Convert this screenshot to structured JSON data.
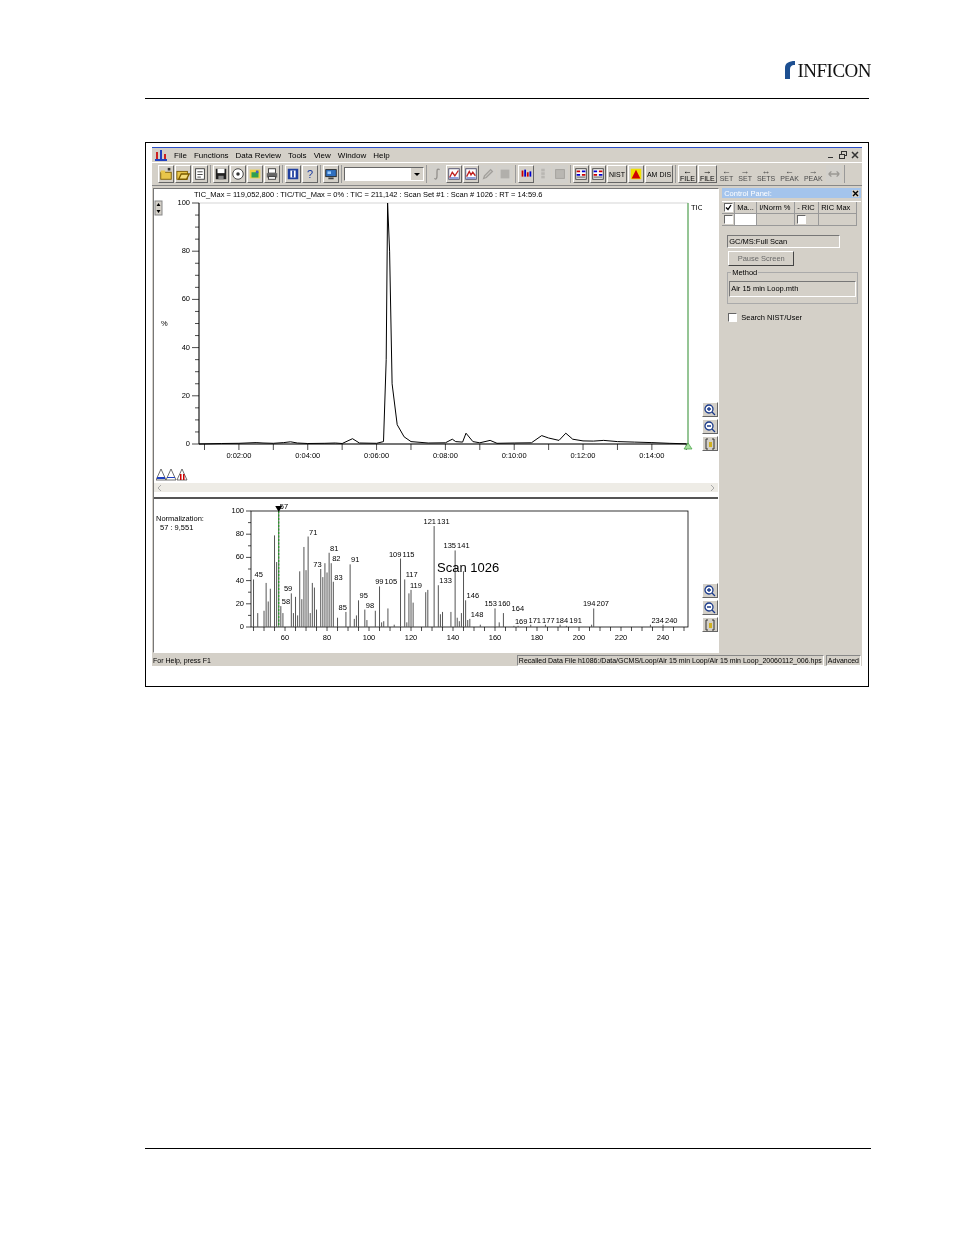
{
  "page_header": {
    "logo_text": "INFICON"
  },
  "window": {
    "menu": [
      "File",
      "Functions",
      "Data Review",
      "Tools",
      "View",
      "Window",
      "Help"
    ],
    "toolbar": [
      [
        {
          "kind": "icon",
          "disabled": false
        },
        {
          "kind": "icon",
          "disabled": false
        },
        {
          "kind": "icon",
          "disabled": false
        }
      ],
      [
        {
          "kind": "icon",
          "disabled": false
        },
        {
          "kind": "icon",
          "disabled": false
        },
        {
          "kind": "icon",
          "disabled": false
        },
        {
          "kind": "icon",
          "disabled": false
        }
      ],
      [
        {
          "kind": "icon",
          "disabled": false
        },
        {
          "kind": "text",
          "text": "?",
          "disabled": false
        }
      ],
      [
        {
          "kind": "icon",
          "disabled": false
        }
      ],
      [
        {
          "kind": "dropdown"
        }
      ],
      [
        {
          "kind": "icon",
          "disabled": true
        },
        {
          "kind": "icon",
          "disabled": false
        },
        {
          "kind": "icon",
          "disabled": false
        },
        {
          "kind": "icon",
          "disabled": true
        },
        {
          "kind": "icon",
          "disabled": true
        }
      ],
      [
        {
          "kind": "icon",
          "disabled": false
        },
        {
          "kind": "icon",
          "disabled": true
        },
        {
          "kind": "icon",
          "disabled": true
        }
      ],
      [
        {
          "kind": "icon",
          "disabled": false
        },
        {
          "kind": "icon",
          "disabled": false
        },
        {
          "kind": "text",
          "text": "NIST",
          "disabled": false
        },
        {
          "kind": "icon",
          "disabled": false
        },
        {
          "kind": "text",
          "text": "AM DIS",
          "disabled": false
        }
      ],
      [
        {
          "kind": "text",
          "text": "FILE",
          "arrow": "←",
          "disabled": false
        },
        {
          "kind": "text",
          "text": "FILE",
          "arrow": "→",
          "disabled": false
        },
        {
          "kind": "text",
          "text": "SET",
          "arrow": "←",
          "disabled": true
        },
        {
          "kind": "text",
          "text": "SET",
          "arrow": "→",
          "disabled": true
        },
        {
          "kind": "text",
          "text": "SETS",
          "arrow": "↔",
          "disabled": true
        },
        {
          "kind": "text",
          "text": "PEAK",
          "arrow": "←",
          "disabled": true
        },
        {
          "kind": "text",
          "text": "PEAK",
          "arrow": "→",
          "disabled": true
        },
        {
          "kind": "icon",
          "disabled": true
        }
      ]
    ],
    "chromatogram": {
      "header": "TIC_Max = 119,052,800 : TIC/TIC_Max = 0% : TIC = 211,142 : Scan Set #1 : Scan #   1026 : RT = 14:59.6",
      "chart_data": {
        "type": "line",
        "ylabel": "%",
        "xlim": [
          0.84,
          15.05
        ],
        "ylim": [
          0,
          100
        ],
        "xticks": [
          {
            "value": 2,
            "label": "0:02:00"
          },
          {
            "value": 4,
            "label": "0:04:00"
          },
          {
            "value": 6,
            "label": "0:06:00"
          },
          {
            "value": 8,
            "label": "0:08:00"
          },
          {
            "value": 10,
            "label": "0:10:00"
          },
          {
            "value": 12,
            "label": "0:12:00"
          },
          {
            "value": 14,
            "label": "0:14:00"
          }
        ],
        "yticks": [
          0,
          20,
          40,
          60,
          80,
          100
        ],
        "x": [
          0.84,
          1.5,
          2.0,
          2.5,
          2.7,
          3.0,
          3.3,
          3.5,
          3.7,
          4.0,
          4.5,
          4.8,
          5.0,
          5.3,
          5.5,
          6.0,
          6.2,
          6.28,
          6.32,
          6.38,
          6.45,
          6.6,
          6.8,
          7.0,
          7.5,
          8.0,
          8.2,
          8.3,
          8.5,
          8.6,
          8.8,
          9.0,
          9.3,
          9.5,
          10.0,
          10.5,
          10.8,
          11.0,
          11.3,
          11.5,
          11.7,
          12.0,
          12.3,
          12.6,
          13.0,
          13.5,
          14.0,
          14.5,
          15.0
        ],
        "series": [
          {
            "name": "TIC",
            "color": "#000000",
            "values": [
              0,
              0.2,
              0.3,
              0.6,
              0.4,
              0.3,
              0.6,
              0.9,
              0.4,
              0.2,
              0.3,
              0.4,
              0.2,
              2.2,
              0.4,
              0.3,
              1,
              35,
              100,
              80,
              25,
              8,
              3,
              1,
              0.4,
              0.5,
              2,
              1,
              0.8,
              4.5,
              1,
              0.5,
              1.5,
              0.3,
              0.4,
              0.5,
              3.5,
              2.5,
              1.5,
              4.5,
              2,
              1.3,
              1.2,
              1.5,
              1,
              0.8,
              0.6,
              0.3,
              0.1
            ]
          }
        ]
      }
    },
    "spectrum": {
      "normalization_label": "Normalization:",
      "normalization_value": "57 : 9,551",
      "chart_data": {
        "type": "bar",
        "xlim": [
          43.8,
          251.9
        ],
        "ylim": [
          0,
          100
        ],
        "xticks": [
          60,
          80,
          100,
          120,
          140,
          160,
          180,
          200,
          220,
          240
        ],
        "yticks": [
          0,
          20,
          40,
          60,
          80,
          100
        ],
        "x": [
          45,
          47,
          50,
          51,
          52,
          53,
          55,
          56,
          57,
          58,
          59,
          63,
          64,
          65,
          66,
          67,
          68,
          69,
          70,
          71,
          72,
          73,
          74,
          75,
          77,
          78,
          79,
          80,
          81,
          82,
          83,
          85,
          89,
          91,
          93,
          94,
          95,
          98,
          99,
          103,
          105,
          106,
          107,
          109,
          112,
          115,
          117,
          118,
          119,
          120,
          121,
          127,
          128,
          131,
          133,
          134,
          135,
          139,
          141,
          142,
          143,
          144,
          145,
          146,
          147,
          148,
          153,
          160,
          162,
          164,
          169,
          171,
          177,
          184,
          191,
          194,
          206,
          207,
          234,
          240
        ],
        "series": [
          {
            "name": "Scan 1026",
            "color": "#555555",
            "values": [
              41,
              12,
              14,
              38,
              22,
              33,
              79,
              56,
              100,
              18,
              12,
              29,
              12,
              26,
              10,
              48,
              24,
              69,
              49,
              78,
              12,
              38,
              34,
              15,
              50,
              43,
              55,
              47,
              64,
              55,
              39,
              8,
              13,
              54,
              7,
              10,
              23,
              15,
              6,
              14,
              35,
              4,
              5,
              16,
              2,
              59,
              41,
              4,
              29,
              32,
              21,
              30,
              32,
              87,
              36,
              11,
              13,
              13,
              66,
              8,
              5,
              12,
              48,
              23,
              6,
              7,
              2,
              16,
              4,
              12,
              1,
              1,
              2,
              2,
              2,
              1,
              2,
              16,
              2,
              2
            ]
          }
        ],
        "value_labels": [
          "45",
          null,
          null,
          null,
          null,
          null,
          null,
          null,
          "57",
          "58",
          "59",
          null,
          null,
          null,
          null,
          null,
          null,
          null,
          null,
          "71",
          null,
          "73",
          null,
          null,
          null,
          null,
          null,
          null,
          "81",
          "82",
          "83",
          "85",
          null,
          "91",
          null,
          null,
          "95",
          "98",
          "99",
          null,
          "105",
          null,
          null,
          "109",
          null,
          "115",
          "117",
          null,
          "119",
          null,
          "121",
          null,
          null,
          "131",
          "133",
          null,
          "135",
          null,
          "141",
          null,
          null,
          null,
          null,
          "146",
          null,
          "148",
          "153",
          "160",
          null,
          "164",
          "169",
          "171",
          "177",
          "184",
          "191",
          "194",
          null,
          "207",
          "234",
          "240"
        ]
      }
    },
    "control_panel": {
      "title": "Control Panel:",
      "header_checked": true,
      "columns": [
        "Ma...",
        "I/Norm %",
        "- RIC",
        "RIC Max"
      ],
      "row_checked": false,
      "row_ric_checked": false,
      "mode": "GC/MS:Full Scan",
      "pause_button": {
        "label": "Pause Screen",
        "disabled": true
      },
      "method": {
        "label": "Method",
        "value": "Air 15 min Loop.mth"
      },
      "search": {
        "label": "Search NIST/User",
        "checked": false
      }
    },
    "status_bar": {
      "help": "For Help, press F1",
      "file": "Recalled Data File h1086:/Data/GCMS/Loop/Air 15 min Loop/Air 15 min Loop_20060112_006.hps",
      "mode": "Advanced"
    }
  }
}
